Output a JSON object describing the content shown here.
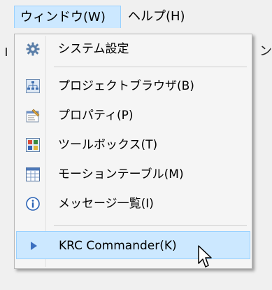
{
  "menubar": {
    "window_label": "ウィンドウ(W)",
    "help_label": "ヘルプ(H)"
  },
  "background": {
    "right_fragment": "ン"
  },
  "menu": {
    "items": [
      {
        "label": "システム設定",
        "icon": "gear-icon"
      },
      {
        "label": "プロジェクトブラウザ(B)",
        "icon": "hierarchy-icon"
      },
      {
        "label": "プロパティ(P)",
        "icon": "properties-icon"
      },
      {
        "label": "ツールボックス(T)",
        "icon": "toolbox-icon"
      },
      {
        "label": "モーションテーブル(M)",
        "icon": "table-icon"
      },
      {
        "label": "メッセージ一覧(I)",
        "icon": "info-icon"
      },
      {
        "label": "KRC Commander(K)",
        "icon": "play-arrow-icon"
      }
    ]
  },
  "colors": {
    "highlight": "#cce8ff",
    "highlight_border": "#99d1ff",
    "menu_bg": "#f5f5f5"
  }
}
